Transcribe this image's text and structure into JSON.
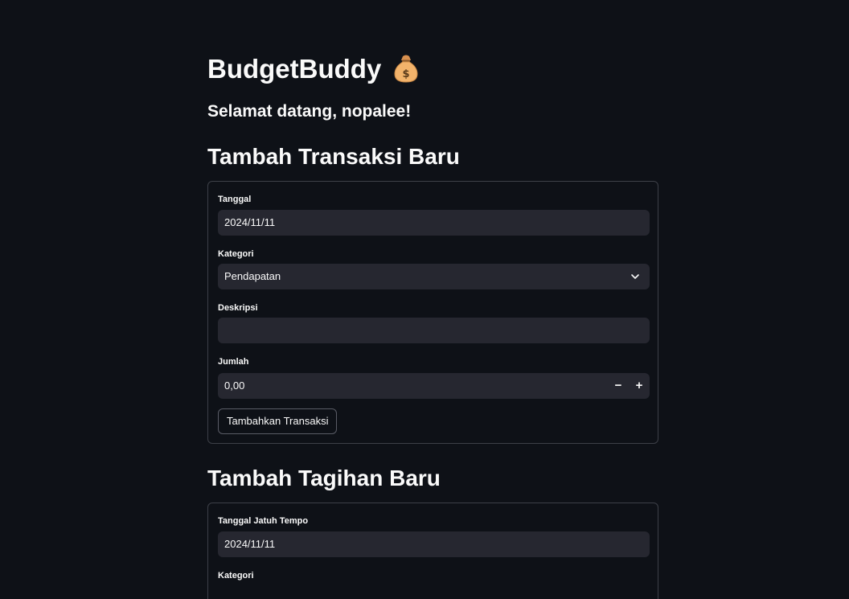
{
  "app": {
    "title": "BudgetBuddy",
    "title_icon": "money-bag-icon",
    "welcome": "Selamat datang, nopalee!"
  },
  "transaction_form": {
    "heading": "Tambah Transaksi Baru",
    "date_label": "Tanggal",
    "date_value": "2024/11/11",
    "category_label": "Kategori",
    "category_value": "Pendapatan",
    "description_label": "Deskripsi",
    "description_value": "",
    "amount_label": "Jumlah",
    "amount_value": "0,00",
    "decrement_label": "−",
    "increment_label": "+",
    "submit_label": "Tambahkan Transaksi"
  },
  "bill_form": {
    "heading": "Tambah Tagihan Baru",
    "due_date_label": "Tanggal Jatuh Tempo",
    "due_date_value": "2024/11/11",
    "category_label": "Kategori"
  },
  "colors": {
    "background": "#0e1117",
    "input_bg": "#262730",
    "border": "#3d4048",
    "text": "#fafafa"
  }
}
